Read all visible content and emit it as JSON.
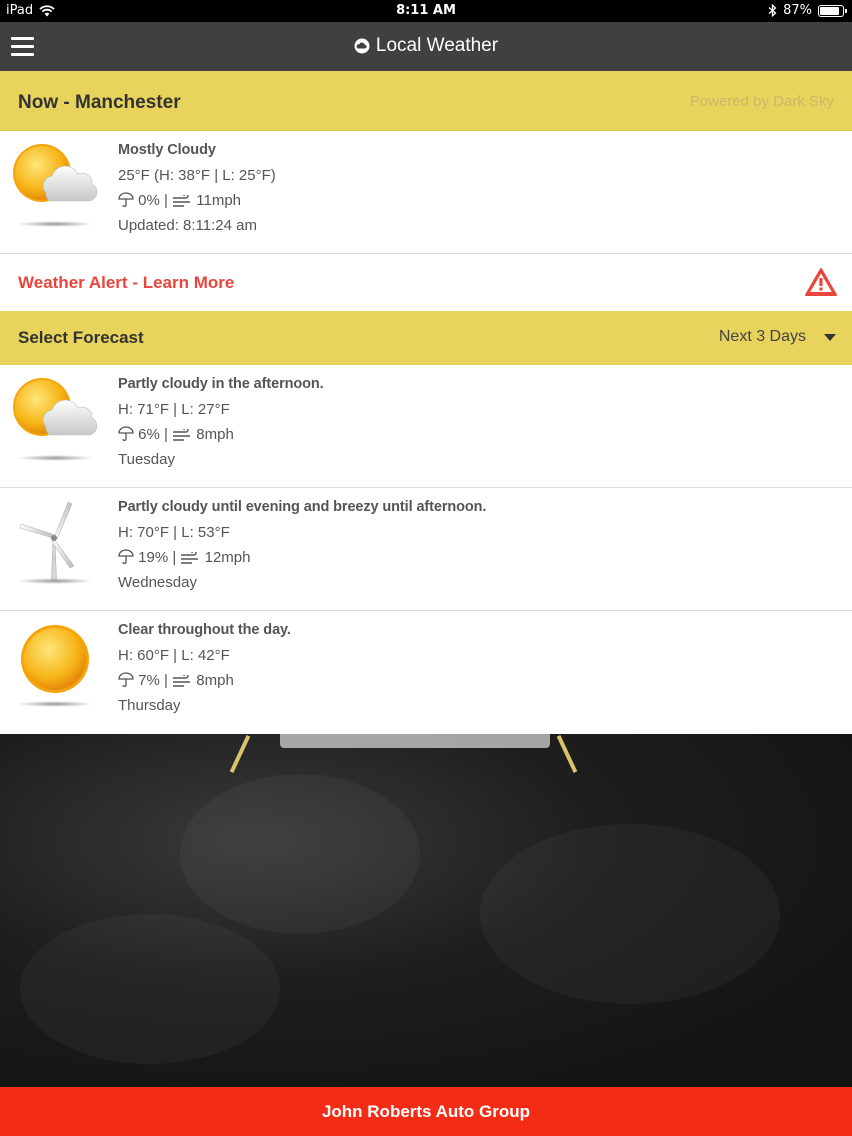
{
  "status_bar": {
    "device": "iPad",
    "time": "8:11 AM",
    "battery": "87%",
    "battery_level": 0.87
  },
  "nav": {
    "title": "Local Weather"
  },
  "current": {
    "header_title": "Now - Manchester",
    "powered_by": "Powered by Dark Sky",
    "summary": "Mostly Cloudy",
    "temps": "25°F (H: 38°F | L: 25°F)",
    "precip": "0%",
    "wind": "11mph",
    "updated": "Updated: 8:11:24 am",
    "icon": "partly-cloudy-icon"
  },
  "alert": {
    "label": "Weather Alert - Learn More",
    "icon": "warning-triangle-icon"
  },
  "forecast": {
    "header_title": "Select Forecast",
    "selected_range": "Next 3 Days",
    "days": [
      {
        "summary": "Partly cloudy in the afternoon.",
        "temps": "H: 71°F | L: 27°F",
        "precip": "6%",
        "wind": "8mph",
        "day": "Tuesday",
        "icon": "partly-cloudy-icon"
      },
      {
        "summary": "Partly cloudy until evening and breezy until afternoon.",
        "temps": "H: 70°F | L: 53°F",
        "precip": "19%",
        "wind": "12mph",
        "day": "Wednesday",
        "icon": "wind-turbine-icon"
      },
      {
        "summary": "Clear throughout the day.",
        "temps": "H: 60°F | L: 42°F",
        "precip": "7%",
        "wind": "8mph",
        "day": "Thursday",
        "icon": "sun-icon"
      }
    ]
  },
  "footer": {
    "label": "John Roberts Auto Group"
  },
  "colors": {
    "accent_gold": "#e8d45c",
    "alert_red": "#e8453c",
    "footer_red": "#f52c15",
    "nav_gray": "#404040"
  }
}
